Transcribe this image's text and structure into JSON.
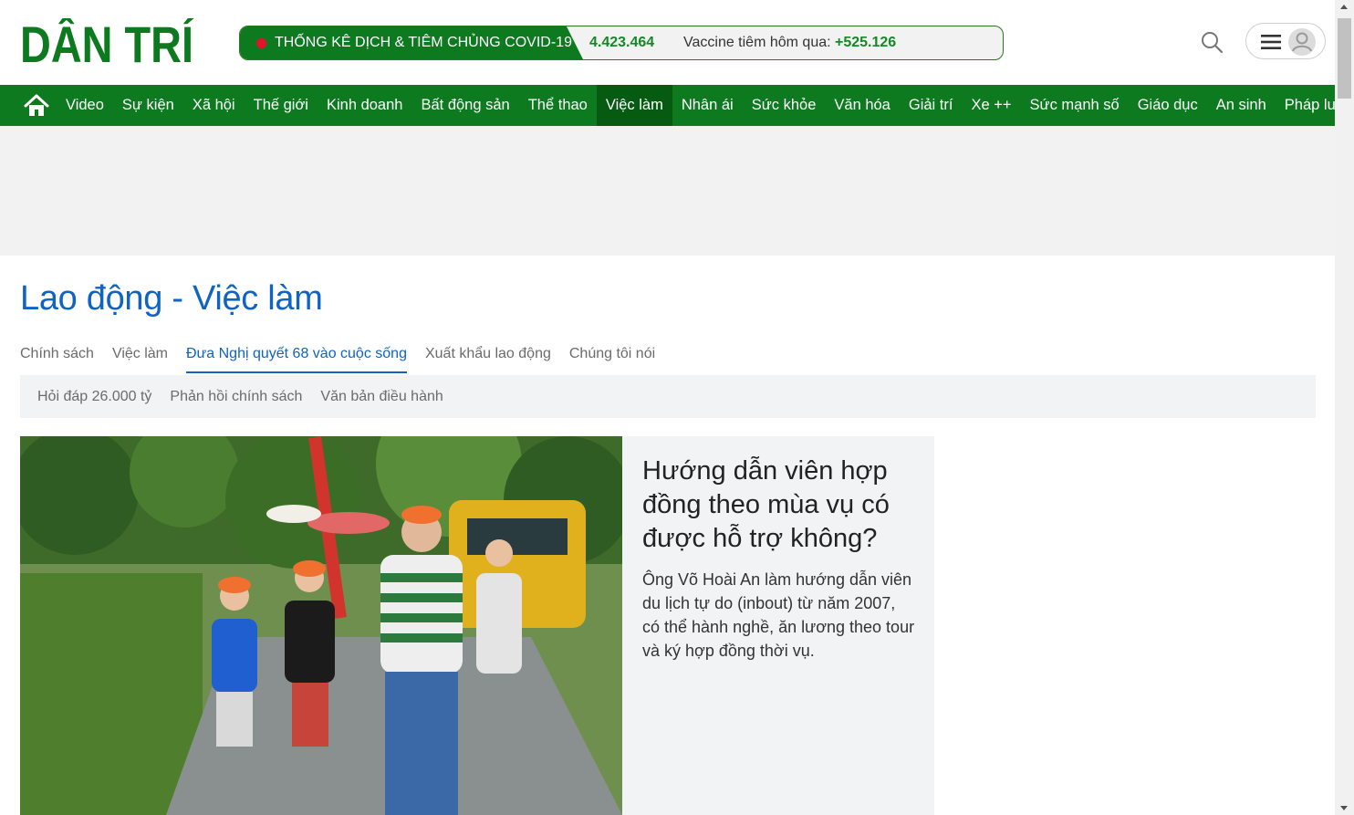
{
  "header": {
    "logo_text": "DÂN TRÍ",
    "covid": {
      "label": "THỐNG KÊ DỊCH & TIÊM CHỦNG COVID-19",
      "count": "4.423.464",
      "vaccine_label": "Vaccine tiêm hôm qua:",
      "vaccine_value": "+525.126"
    },
    "search_icon": "search-icon",
    "menu_icon": "hamburger-icon",
    "avatar_icon": "user-avatar-icon"
  },
  "nav": {
    "home_icon": "home-icon",
    "items": [
      "Video",
      "Sự kiện",
      "Xã hội",
      "Thế giới",
      "Kinh doanh",
      "Bất động sản",
      "Thể thao",
      "Việc làm",
      "Nhân ái",
      "Sức khỏe",
      "Văn hóa",
      "Giải trí",
      "Xe ++",
      "Sức mạnh số",
      "Giáo dục",
      "An sinh",
      "Pháp luật"
    ],
    "active": "Việc làm"
  },
  "section": {
    "title": "Lao động - Việc làm",
    "tabs": [
      "Chính sách",
      "Việc làm",
      "Đưa Nghị quyết 68 vào cuộc sống",
      "Xuất khẩu lao động",
      "Chúng tôi nói"
    ],
    "active_tab": "Đưa Nghị quyết 68 vào cuộc sống",
    "subtabs": [
      "Hỏi đáp 26.000 tỷ",
      "Phản hồi chính sách",
      "Văn bản điều hành"
    ]
  },
  "featured": {
    "title": "Hướng dẫn viên hợp đồng theo mùa vụ có được hỗ trợ không?",
    "description": "Ông Võ Hoài An làm hướng dẫn viên du lịch tự do (inbout) từ năm 2007, có thể hành nghề, ăn lương theo tour và ký hợp đồng thời vụ."
  },
  "colors": {
    "brand_green": "#0d7a1f",
    "active_nav": "#075a12",
    "title_blue": "#0e63c4",
    "covid_red": "#e8102a"
  }
}
